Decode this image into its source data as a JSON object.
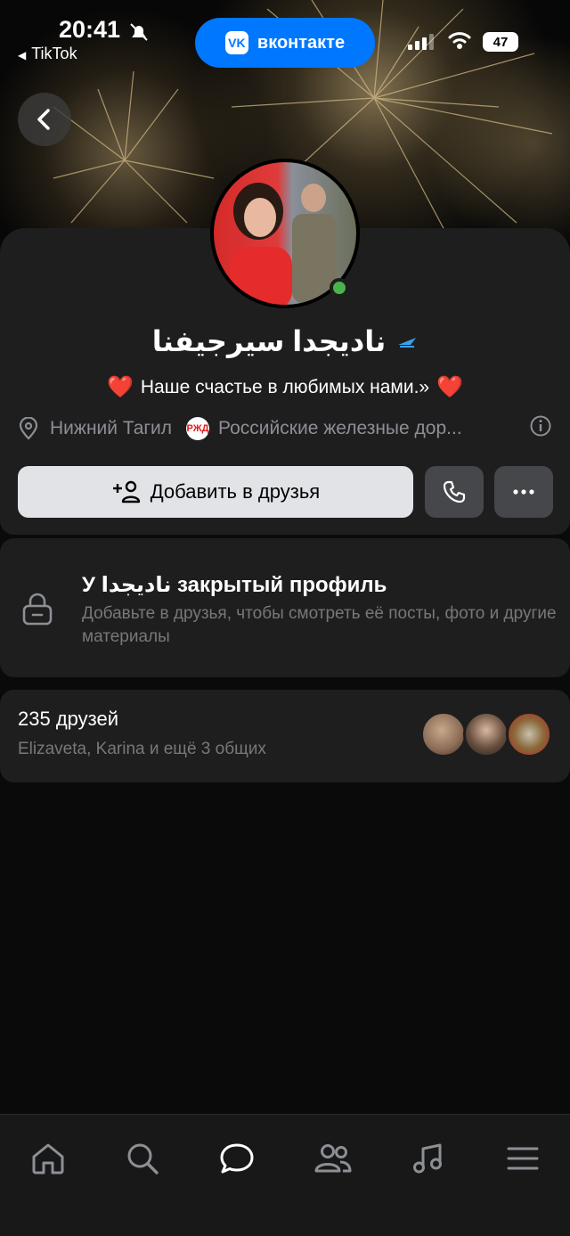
{
  "status_bar": {
    "time": "20:41",
    "back_app": "TikTok",
    "app_pill": "вконтакте",
    "vk_logo": "VK",
    "battery": "47",
    "icons": [
      "bell-slash-icon",
      "signal-icon",
      "wifi-icon",
      "battery-icon"
    ]
  },
  "profile": {
    "name": "ناديجدا سيرجيفنا",
    "status_text": "Наше счастье в любимых нами.»",
    "heart": "❤️",
    "city": "Нижний Тагил",
    "work_logo": "РЖД",
    "work": "Российские железные дор...",
    "online": true
  },
  "actions": {
    "add_friend": "Добавить в друзья",
    "icons": [
      "add-user-icon",
      "phone-icon",
      "more-icon"
    ]
  },
  "closed_profile": {
    "title": "У ناديجدا закрытый профиль",
    "description": "Добавьте в друзья, чтобы смотреть её посты, фото и другие материалы"
  },
  "friends": {
    "count": "235 друзей",
    "mutual": "Elizaveta, Karina и ещё 3 общих"
  },
  "tabbar": {
    "items": [
      "home-icon",
      "search-icon",
      "messages-icon",
      "friends-icon",
      "music-icon",
      "menu-icon"
    ],
    "active": "messages-icon"
  },
  "colors": {
    "accent": "#0077ff",
    "online": "#4bb34b",
    "card_bg": "#1e1e1f",
    "page_bg": "#0a0a0a"
  }
}
